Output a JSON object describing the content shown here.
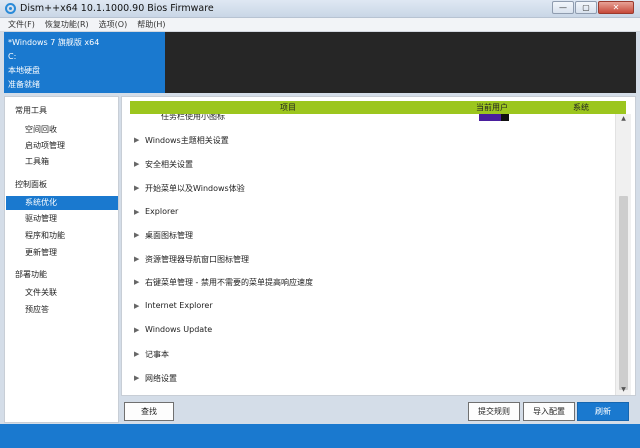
{
  "window": {
    "title": "Dism++x64 10.1.1000.90 Bios Firmware",
    "min": "—",
    "max": "▢",
    "close": "✕"
  },
  "menu": [
    "文件(F)",
    "恢复功能(R)",
    "选项(O)",
    "帮助(H)"
  ],
  "info": [
    "*Windows 7 旗舰版 x64",
    "C:",
    "本地硬盘",
    "准备就绪"
  ],
  "sidebar": {
    "groups": [
      {
        "title": "常用工具",
        "items": [
          "空间回收",
          "启动项管理",
          "工具箱"
        ]
      },
      {
        "title": "控制面板",
        "items": [
          "系统优化",
          "驱动管理",
          "程序和功能",
          "更新管理"
        ]
      },
      {
        "title": "部署功能",
        "items": [
          "文件关联",
          "预应答"
        ]
      }
    ],
    "active": "系统优化"
  },
  "table": {
    "headers": {
      "item": "项目",
      "current_user": "当前用户",
      "system": "系统"
    },
    "partial_label": "任务栏使用小图标",
    "rows": [
      "Windows主题相关设置",
      "安全相关设置",
      "开始菜单以及Windows体验",
      "Explorer",
      "桌面图标管理",
      "资源管理器导航窗口图标管理",
      "右键菜单管理 - 禁用不需要的菜单提高响应速度",
      "Internet Explorer",
      "Windows Update",
      "记事本",
      "网络设置"
    ]
  },
  "buttons": {
    "search": "查找",
    "submit_rules": "提交规则",
    "import": "导入配置",
    "refresh": "刷新"
  },
  "colors": {
    "accent": "#1a79cf",
    "header_green": "#9cc61e",
    "toggle_on": "#4a1f9d"
  }
}
